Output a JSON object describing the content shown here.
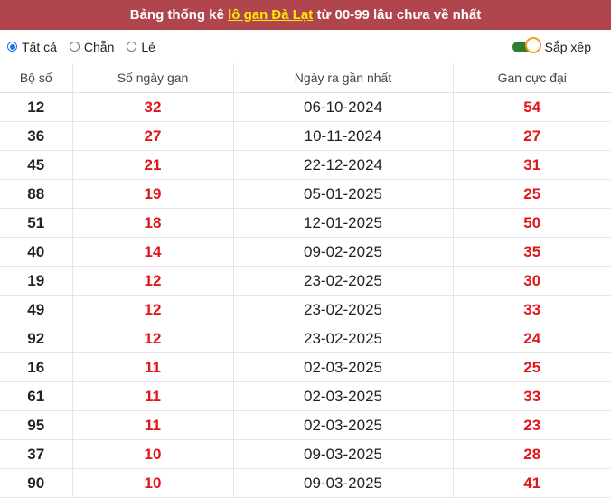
{
  "header": {
    "before": "Bảng thống kê ",
    "highlight": "lô gan Đà Lạt",
    "after": " từ 00-99 lâu chưa về nhất"
  },
  "filters": {
    "options": [
      "Tất cả",
      "Chẵn",
      "Lẻ"
    ],
    "selected": "Tất cả",
    "sort_label": "Sắp xếp",
    "sort_on": true
  },
  "table": {
    "columns": [
      "Bộ số",
      "Số ngày gan",
      "Ngày ra gần nhất",
      "Gan cực đại"
    ],
    "rows": [
      [
        "12",
        "32",
        "06-10-2024",
        "54"
      ],
      [
        "36",
        "27",
        "10-11-2024",
        "27"
      ],
      [
        "45",
        "21",
        "22-12-2024",
        "31"
      ],
      [
        "88",
        "19",
        "05-01-2025",
        "25"
      ],
      [
        "51",
        "18",
        "12-01-2025",
        "50"
      ],
      [
        "40",
        "14",
        "09-02-2025",
        "35"
      ],
      [
        "19",
        "12",
        "23-02-2025",
        "30"
      ],
      [
        "49",
        "12",
        "23-02-2025",
        "33"
      ],
      [
        "92",
        "12",
        "23-02-2025",
        "24"
      ],
      [
        "16",
        "11",
        "02-03-2025",
        "25"
      ],
      [
        "61",
        "11",
        "02-03-2025",
        "33"
      ],
      [
        "95",
        "11",
        "02-03-2025",
        "23"
      ],
      [
        "37",
        "10",
        "09-03-2025",
        "28"
      ],
      [
        "90",
        "10",
        "09-03-2025",
        "41"
      ]
    ]
  },
  "colors": {
    "header_bg": "#b0454d",
    "highlight": "#ffea00",
    "value_red": "#e0161b",
    "toggle_on": "#2e7d32"
  }
}
